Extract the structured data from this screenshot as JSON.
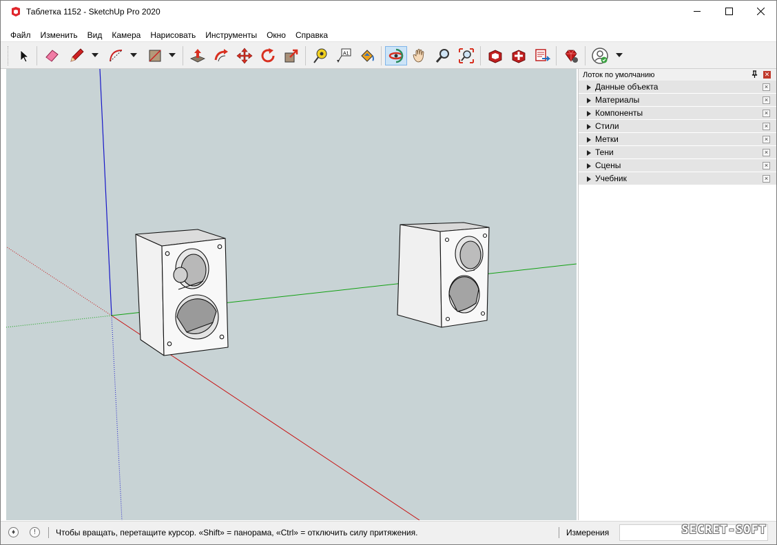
{
  "window": {
    "title": "Таблетка 1152 - SketchUp Pro 2020",
    "controls": {
      "minimize": "minimize-icon",
      "maximize": "maximize-icon",
      "close": "close-icon"
    }
  },
  "menu": [
    "Файл",
    "Изменить",
    "Вид",
    "Камера",
    "Нарисовать",
    "Инструменты",
    "Окно",
    "Справка"
  ],
  "toolbar": {
    "tools": [
      "select-tool",
      "eraser-tool",
      "line-tool",
      "arc-tool",
      "rectangle-tool",
      "push-pull-tool",
      "offset-tool",
      "move-tool",
      "rotate-tool",
      "scale-tool",
      "tape-measure-tool",
      "text-tool",
      "paint-bucket-tool",
      "orbit-tool",
      "pan-tool",
      "zoom-tool",
      "zoom-extents-tool",
      "3d-warehouse",
      "extension-warehouse",
      "layout-send",
      "extension-manager",
      "account"
    ],
    "active_tool": "orbit-tool"
  },
  "tray": {
    "title": "Лоток по умолчанию",
    "panels": [
      "Данные объекта",
      "Материалы",
      "Компоненты",
      "Стили",
      "Метки",
      "Тени",
      "Сцены",
      "Учебник"
    ]
  },
  "status": {
    "hint": "Чтобы вращать, перетащите курсор. «Shift» = панорама, «Ctrl» = отключить силу притяжения.",
    "measurements_label": "Измерения",
    "measurements_value": "",
    "watermark": "SECRET-SOFT"
  },
  "colors": {
    "viewport_bg": "#c8d3d5",
    "axis_red": "#d01010",
    "axis_green": "#10a010",
    "axis_blue": "#1010d0",
    "tray_row_bg": "#e4e4e4",
    "active_tool_bg": "#cce4f7"
  }
}
